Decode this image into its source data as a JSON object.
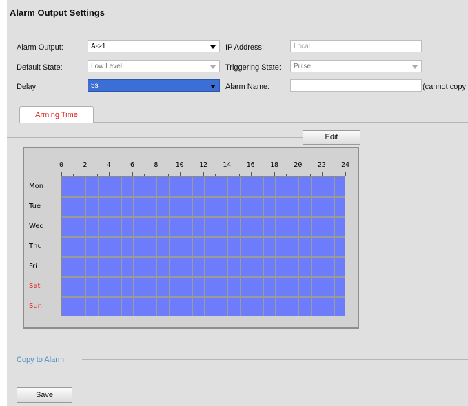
{
  "title": "Alarm Output Settings",
  "form": {
    "alarm_output": {
      "label": "Alarm Output:",
      "value": "A->1"
    },
    "ip_address": {
      "label": "IP Address:",
      "placeholder": "Local"
    },
    "default_state": {
      "label": "Default State:",
      "value": "Low Level"
    },
    "triggering_state": {
      "label": "Triggering State:",
      "value": "Pulse"
    },
    "delay": {
      "label": "Delay",
      "value": "5s"
    },
    "alarm_name": {
      "label": "Alarm Name:",
      "value": "",
      "note": "(cannot copy"
    }
  },
  "tabs": [
    {
      "label": "Arming Time",
      "active": true
    }
  ],
  "schedule": {
    "edit_label": "Edit",
    "hour_labels": [
      "0",
      "2",
      "4",
      "6",
      "8",
      "10",
      "12",
      "14",
      "16",
      "18",
      "20",
      "22",
      "24"
    ],
    "days": [
      {
        "label": "Mon",
        "weekend": false
      },
      {
        "label": "Tue",
        "weekend": false
      },
      {
        "label": "Wed",
        "weekend": false
      },
      {
        "label": "Thu",
        "weekend": false
      },
      {
        "label": "Fri",
        "weekend": false
      },
      {
        "label": "Sat",
        "weekend": true
      },
      {
        "label": "Sun",
        "weekend": true
      }
    ],
    "armed_color": "#6c7cfa",
    "weekend_color": "#e02020"
  },
  "copy_to_alarm": "Copy to Alarm",
  "save_label": "Save"
}
